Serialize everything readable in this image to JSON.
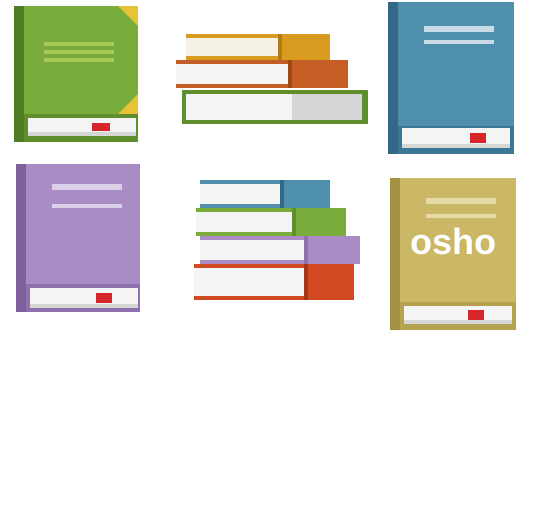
{
  "colors": {
    "green_book": "#7aac3c",
    "blue_book": "#4e8fad",
    "purple_book": "#a98cc4",
    "khaki_book": "#cbb866",
    "page_white": "#f4f4f4",
    "bookmark_red": "#d7262b",
    "corner_gold": "#e8c33a"
  },
  "icons": [
    "green-book-icon",
    "book-stack-icon",
    "blue-book-icon",
    "purple-book-icon",
    "book-stack-colorful-icon",
    "khaki-book-icon"
  ],
  "overlay": {
    "text": "osho"
  }
}
